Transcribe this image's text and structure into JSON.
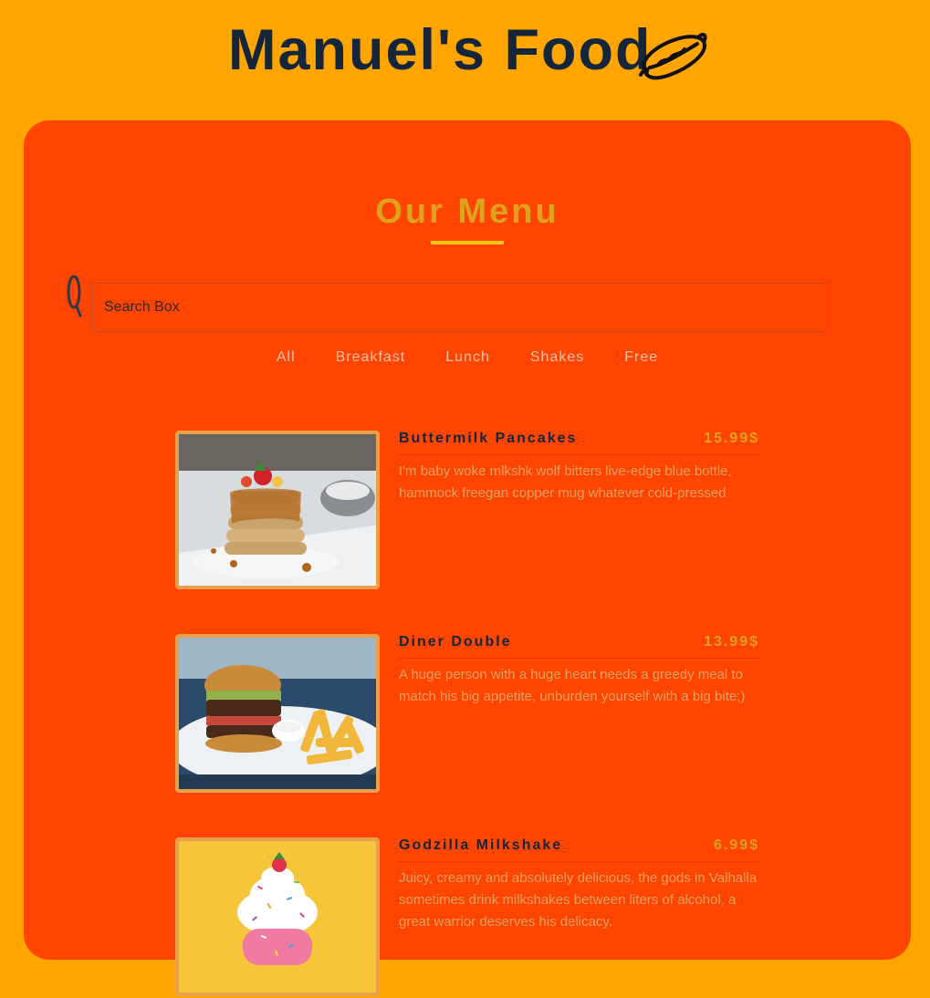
{
  "header": {
    "title": "Manuel's Food",
    "icon": "hotdog-icon"
  },
  "menu": {
    "title": "Our Menu",
    "search": {
      "placeholder": "Search Box",
      "value": "",
      "icon": "search-icon"
    },
    "filters": [
      "All",
      "Breakfast",
      "Lunch",
      "Shakes",
      "Free"
    ],
    "items": [
      {
        "name": "Buttermilk Pancakes",
        "price": "15.99$",
        "description": "I'm baby woke mlkshk wolf bitters live-edge blue bottle, hammock freegan copper mug whatever cold-pressed",
        "image": "pancakes-photo"
      },
      {
        "name": "Diner Double",
        "price": "13.99$",
        "description": "A huge person with a huge heart needs a greedy meal to match his big appetite, unburden yourself with a big bite;)",
        "image": "burger-photo"
      },
      {
        "name": "Godzilla Milkshake",
        "price": "6.99$",
        "description": "Juicy, creamy and absolutely delicious, the gods in Valhalla sometimes drink milkshakes between liters of alcohol, a great warrior deserves his delicacy.",
        "image": "milkshake-photo"
      }
    ]
  },
  "colors": {
    "page_bg": "#FFA500",
    "panel_bg": "#FF4500",
    "title_dark": "#15263a",
    "accent_gold": "#E0A21C",
    "underline": "#F2C80F"
  }
}
